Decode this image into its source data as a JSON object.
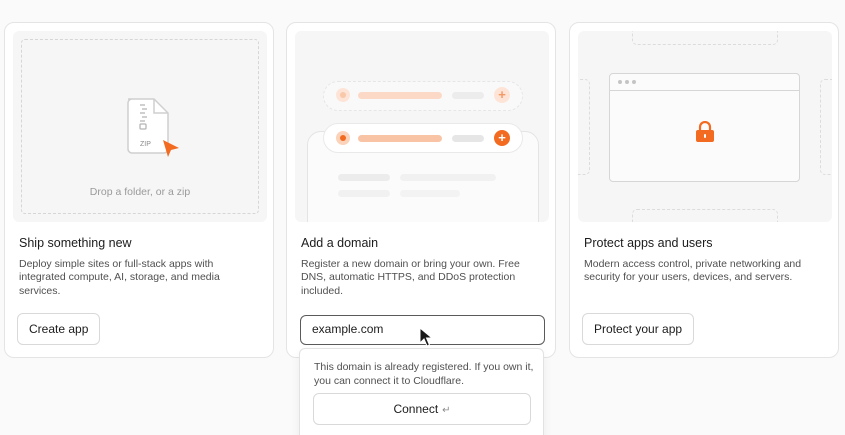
{
  "cards": [
    {
      "title": "Ship something new",
      "description": "Deploy simple sites or full-stack apps with integrated compute, AI, storage, and media services.",
      "button_label": "Create app",
      "illustration": {
        "file_label": "ZIP",
        "drop_text": "Drop a folder, or a zip"
      }
    },
    {
      "title": "Add a domain",
      "description": "Register a new domain or bring your own. Free DNS, automatic HTTPS, and DDoS protection included.",
      "input_value": "example.com",
      "popover": {
        "message": "This domain is already registered. If you own it, you can connect it to Cloudflare.",
        "button_label": "Connect",
        "button_icon": "↵"
      }
    },
    {
      "title": "Protect apps and users",
      "description": "Modern access control, private networking and security for your users, devices, and servers.",
      "button_label": "Protect your app"
    }
  ],
  "colors": {
    "accent": "#f26b21",
    "accent_light": "#fbd2ba",
    "accent_soft": "#fde4d6"
  }
}
